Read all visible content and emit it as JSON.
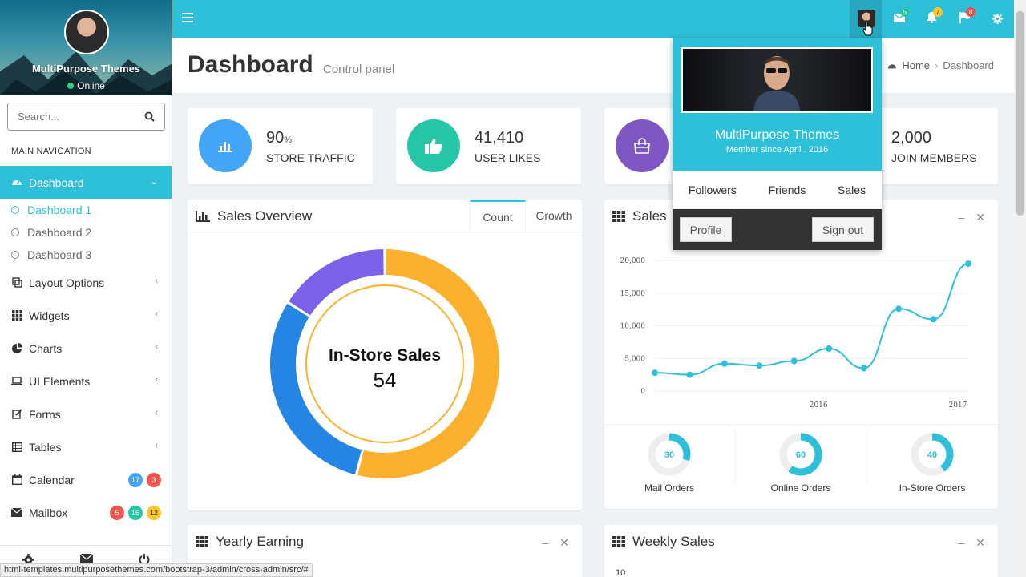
{
  "sidebar": {
    "user": {
      "name": "MultiPurpose Themes",
      "status": "Online"
    },
    "search": {
      "placeholder": "Search..."
    },
    "nav_header": "MAIN NAVIGATION",
    "items": [
      {
        "label": "Dashboard",
        "icon": "dashboard-icon",
        "active": true
      },
      {
        "label": "Layout Options",
        "icon": "layout-icon"
      },
      {
        "label": "Widgets",
        "icon": "widgets-icon"
      },
      {
        "label": "Charts",
        "icon": "pie-chart-icon"
      },
      {
        "label": "UI Elements",
        "icon": "laptop-icon"
      },
      {
        "label": "Forms",
        "icon": "edit-icon"
      },
      {
        "label": "Tables",
        "icon": "table-icon"
      },
      {
        "label": "Calendar",
        "icon": "calendar-icon",
        "badges": [
          "17",
          "3"
        ]
      },
      {
        "label": "Mailbox",
        "icon": "envelope-icon",
        "badges": [
          "5",
          "16",
          "12"
        ]
      }
    ],
    "sub_items": [
      "Dashboard 1",
      "Dashboard 2",
      "Dashboard 3"
    ]
  },
  "topbar": {
    "badges": {
      "mail": "5",
      "bell": "7",
      "flag": "8"
    },
    "colors": {
      "accent": "#2ebfd9"
    }
  },
  "header": {
    "title": "Dashboard",
    "subtitle": "Control panel",
    "breadcrumb": [
      "Home",
      "Dashboard"
    ]
  },
  "stats": [
    {
      "value": "90",
      "unit": "%",
      "label": "STORE TRAFFIC",
      "color": "#42a5f5"
    },
    {
      "value": "41,410",
      "label": "USER LIKES",
      "color": "#26c6a6"
    },
    {
      "value": "",
      "label": "",
      "color": "#7e57c2"
    },
    {
      "value": "2,000",
      "label": "JOIN MEMBERS",
      "color": "#2ebfd9"
    }
  ],
  "sales_overview": {
    "title": "Sales Overview",
    "tabs": [
      "Count",
      "Growth"
    ],
    "center_label": "In-Store Sales",
    "center_value": "54"
  },
  "sales_box": {
    "title": "Sales"
  },
  "yearly": {
    "title": "Yearly Earning"
  },
  "weekly": {
    "title": "Weekly Sales",
    "y_label": "10"
  },
  "dropdown": {
    "name": "MultiPurpose Themes",
    "since": "Member since April . 2016",
    "links": [
      "Followers",
      "Friends",
      "Sales"
    ],
    "profile": "Profile",
    "signout": "Sign out"
  },
  "mini_donuts": [
    {
      "value": 30,
      "label": "Mail Orders"
    },
    {
      "value": 60,
      "label": "Online Orders"
    },
    {
      "value": 40,
      "label": "In-Store Orders"
    }
  ],
  "chart_data": [
    {
      "type": "pie",
      "labels": [
        "In-Store Sales",
        "",
        ""
      ],
      "values": [
        54,
        30,
        16
      ],
      "colors": [
        "#fbb12d",
        "#2585e4",
        "#7b61e8"
      ]
    },
    {
      "type": "line",
      "x_ticks": [
        "2016",
        "2017"
      ],
      "y_ticks": [
        "20,000",
        "15,000",
        "10,000",
        "5,000",
        "0"
      ],
      "ylim": [
        0,
        20000
      ],
      "series": [
        {
          "values": [
            2800,
            2500,
            4200,
            3900,
            4600,
            6500,
            3500,
            12600,
            11000,
            19500
          ],
          "color": "#2ebfd9"
        }
      ]
    }
  ],
  "statusbar": "html-templates.multipurposethemes.com/bootstrap-3/admin/cross-admin/src/#"
}
